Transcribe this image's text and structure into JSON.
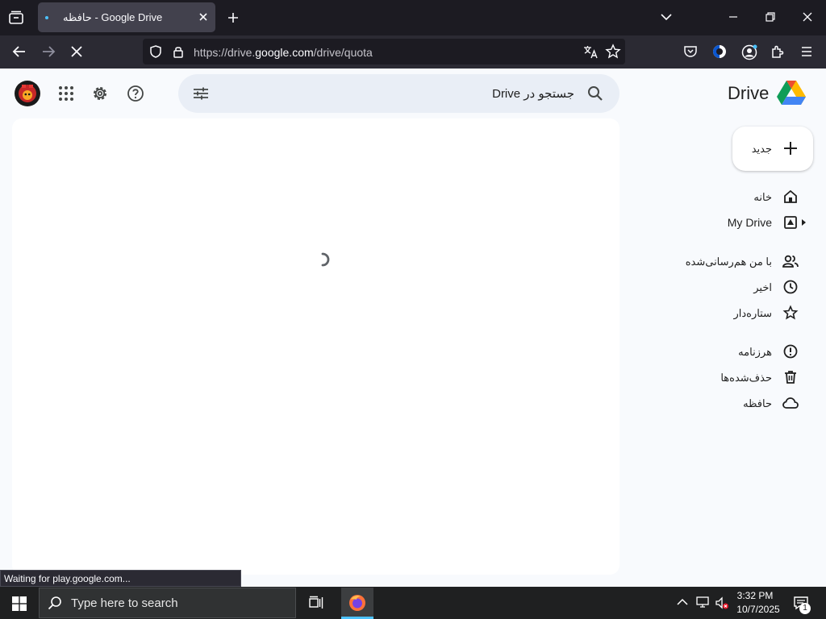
{
  "browser": {
    "tab_title": "حافظه - Google Drive",
    "url_prefix": "https://drive.",
    "url_domain": "google.com",
    "url_path": "/drive/quota",
    "status_text": "Waiting for play.google.com...",
    "colors": {
      "chrome_dark": "#1c1b22",
      "toolbar": "#2b2a33",
      "tab_active": "#42414d"
    }
  },
  "drive": {
    "app_title": "Drive",
    "search_placeholder": "جستجو در Drive",
    "new_button_label": "جدید",
    "nav": {
      "home": "خانه",
      "my_drive": "My Drive",
      "shared": "با من هم‌رسانی‌شده",
      "recent": "اخیر",
      "starred": "ستاره‌دار",
      "spam": "هرزنامه",
      "trash": "حذف‌شده‌ها",
      "storage": "حافظه"
    },
    "colors": {
      "background": "#f8fafd",
      "search_bg": "#e9eef6",
      "spinner": "#1a73e8"
    }
  },
  "taskbar": {
    "search_placeholder": "Type here to search",
    "time": "3:32 PM",
    "date": "10/7/2025",
    "notification_count": "1"
  }
}
